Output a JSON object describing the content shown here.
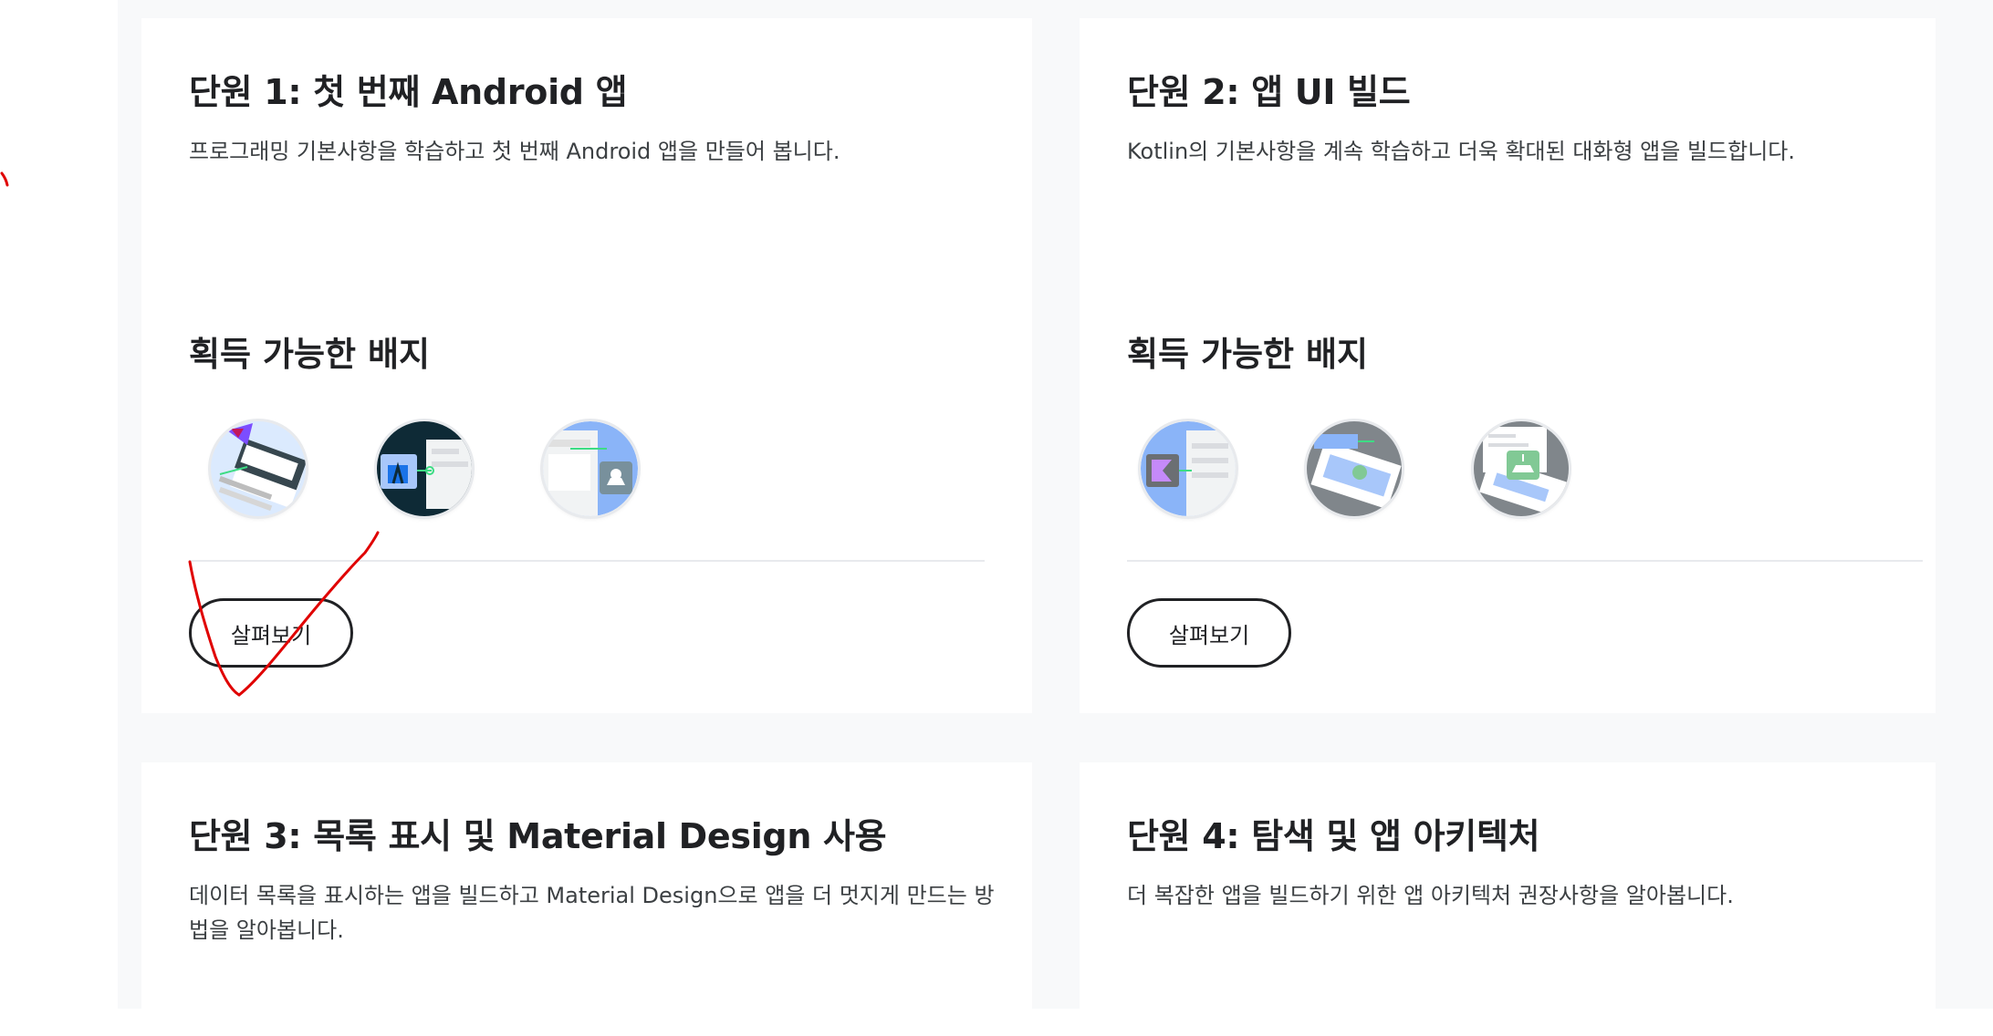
{
  "units": [
    {
      "title": "단원 1: 첫 번째 Android 앱",
      "description": "프로그래밍 기본사항을 학습하고 첫 번째 Android 앱을 만들어 봅니다.",
      "badges_heading": "획득 가능한 배지",
      "badges": [
        "kotlin-badge-icon",
        "android-studio-badge-icon",
        "compose-app-badge-icon"
      ],
      "button_label": "살펴보기"
    },
    {
      "title": "단원 2: 앱 UI 빌드",
      "description": "Kotlin의 기본사항을 계속 학습하고 더욱 확대된 대화형 앱을 빌드합니다.",
      "badges_heading": "획득 가능한 배지",
      "badges": [
        "kotlin-class-badge-icon",
        "interactive-app-badge-icon",
        "scrollable-list-badge-icon"
      ],
      "button_label": "살펴보기"
    },
    {
      "title": "단원 3: 목록 표시 및 Material Design 사용",
      "description": "데이터 목록을 표시하는 앱을 빌드하고 Material Design으로 앱을 더 멋지게 만드는 방법을 알아봅니다."
    },
    {
      "title": "단원 4: 탐색 및 앱 아키텍처",
      "description": "더 복잡한 앱을 빌드하기 위한 앱 아키텍처 권장사항을 알아봅니다."
    }
  ],
  "colors": {
    "page_bg": "#f8f9fa",
    "card_bg": "#ffffff",
    "text": "#202124",
    "button_border": "#202124",
    "annotation": "#e00000"
  }
}
